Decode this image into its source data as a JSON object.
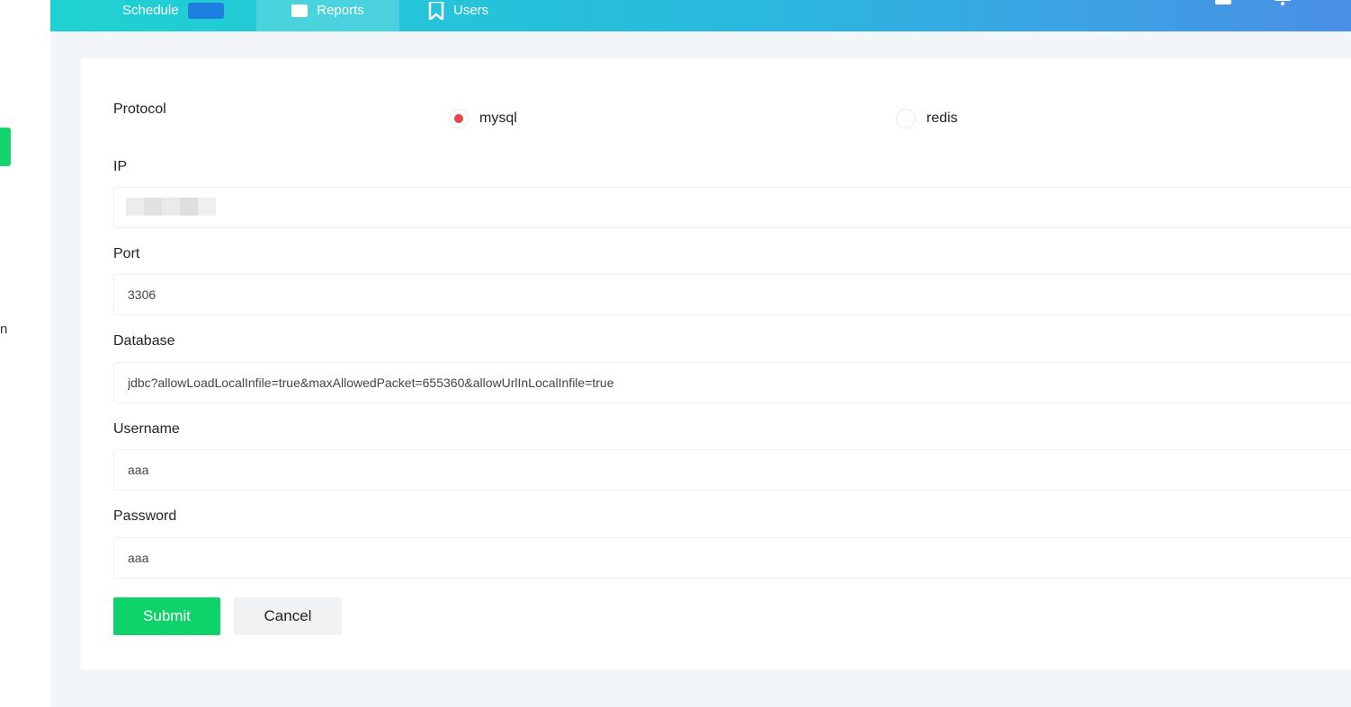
{
  "sidebar": {
    "fragment_text": "n"
  },
  "topbar": {
    "nav": {
      "schedule_label": "Schedule",
      "reports_label": "Reports",
      "users_label": "Users"
    }
  },
  "form": {
    "protocol": {
      "label": "Protocol",
      "options": [
        "mysql",
        "redis"
      ],
      "selected": "mysql"
    },
    "ip": {
      "label": "IP",
      "value": ""
    },
    "port": {
      "label": "Port",
      "value": "3306"
    },
    "database": {
      "label": "Database",
      "value": "jdbc?allowLoadLocalInfile=true&maxAllowedPacket=655360&allowUrlInLocalInfile=true"
    },
    "username": {
      "label": "Username",
      "value": "aaa"
    },
    "password": {
      "label": "Password",
      "value": "aaa"
    },
    "submit_label": "Submit",
    "cancel_label": "Cancel"
  },
  "colors": {
    "accent_green": "#0ed26a",
    "radio_selected": "#e2464a",
    "header_gradient_start": "#1fd2d1",
    "header_gradient_end": "#4a8fe6"
  },
  "icons": [
    "clipboard-icon",
    "bell-icon",
    "bookmark-icon",
    "reports-icon"
  ]
}
